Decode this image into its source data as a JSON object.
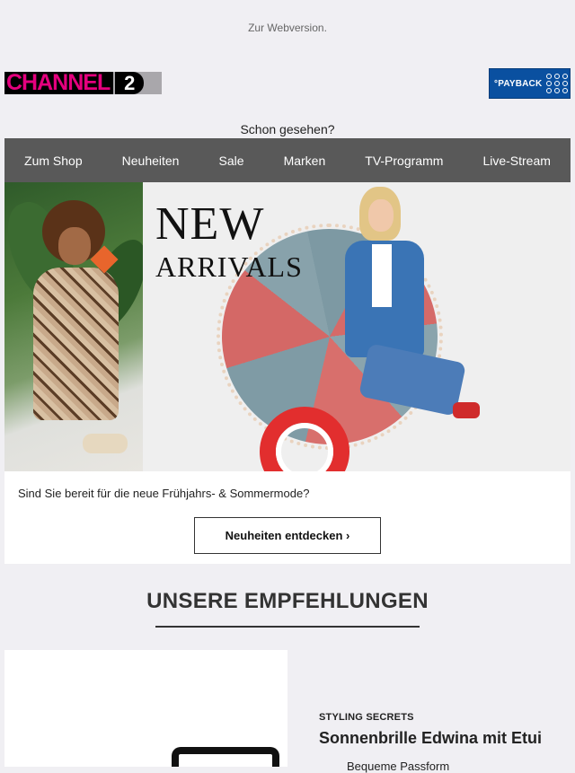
{
  "header": {
    "webversion_link": "Zur Webversion.",
    "logo_text": "CHANNEL",
    "logo_number": "2",
    "payback_label": "°PAYBACK",
    "intro": "Schon gesehen?"
  },
  "nav": {
    "items": [
      {
        "label": "Zum Shop"
      },
      {
        "label": "Neuheiten"
      },
      {
        "label": "Sale"
      },
      {
        "label": "Marken"
      },
      {
        "label": "TV-Programm"
      },
      {
        "label": "Live-Stream"
      }
    ],
    "background": "#595959"
  },
  "hero": {
    "title_line1": "NEW",
    "title_line2": "ARRIVALS"
  },
  "teaser": {
    "text": "Sind Sie bereit für die neue Frühjahrs- & Sommermode?",
    "button_label": "Neuheiten entdecken ›"
  },
  "recommendations": {
    "title": "UNSERE EMPFEHLUNGEN",
    "product": {
      "category": "STYLING SECRETS",
      "name": "Sonnenbrille Edwina mit Etui",
      "desc": "Bequeme Passform"
    }
  },
  "colors": {
    "logo_pink": "#e5007e",
    "payback_blue": "#0a50a0",
    "page_bg": "#f0eff3"
  }
}
